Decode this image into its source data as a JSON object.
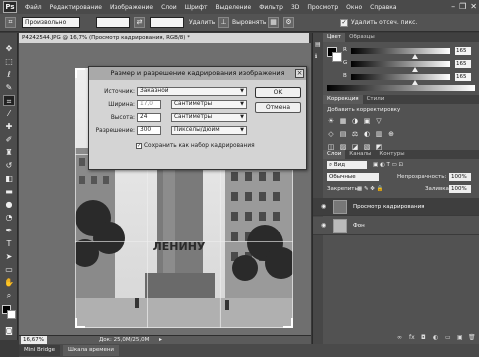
{
  "app": {
    "logo": "Ps"
  },
  "menubar": {
    "items": [
      "Файл",
      "Редактирование",
      "Изображение",
      "Слои",
      "Шрифт",
      "Выделение",
      "Фильтр",
      "3D",
      "Просмотр",
      "Окно",
      "Справка"
    ]
  },
  "optionsbar": {
    "ratio": "Произвольно",
    "clear_label": "Удалить",
    "straighten_label": "Выровнять",
    "delete_pixels_label": "Удалить отсеч. пикс."
  },
  "document": {
    "tab_title": "P4242544.JPG @ 16,7% (Просмотр кадрирования, RGB/8) *",
    "zoom": "16,67%",
    "doc_size": "Док: 25,0M/25,0M"
  },
  "dialog": {
    "title": "Размер и разрешение кадрирования изображения",
    "source_label": "Источник:",
    "source_value": "Заказной",
    "width_label": "Ширина:",
    "width_value": "17,0",
    "height_label": "Высота:",
    "height_value": "24",
    "resolution_label": "Разрешение:",
    "resolution_value": "300",
    "unit_cm": "Сантиметры",
    "unit_ppi": "Пикселы/дюйм",
    "save_preset_label": "Сохранить как набор кадрирования",
    "ok_label": "OK",
    "cancel_label": "Отмена"
  },
  "colorpanel": {
    "tabs": [
      "Цвет",
      "Образцы"
    ],
    "channels": [
      {
        "label": "R",
        "value": "165",
        "pos": 0.65
      },
      {
        "label": "G",
        "value": "165",
        "pos": 0.65
      },
      {
        "label": "B",
        "value": "165",
        "pos": 0.65
      }
    ]
  },
  "adjustments": {
    "tabs": [
      "Коррекция",
      "Стили"
    ],
    "subtitle": "Добавить корректировку",
    "icons": [
      "☀",
      "▦",
      "◑",
      "▣",
      "▽",
      "◇",
      "▤",
      "⚖",
      "◐",
      "▥",
      "⊕",
      "◫",
      "▨",
      "◪",
      "▧",
      "◩"
    ]
  },
  "layerspanel": {
    "tabs": [
      "Слои",
      "Каналы",
      "Контуры"
    ],
    "kind_label": "Вид",
    "blend_mode": "Обычные",
    "opacity_label": "Непрозрачность:",
    "opacity_value": "100%",
    "lock_label": "Закрепить:",
    "fill_label": "Заливка:",
    "fill_value": "100%",
    "layers": [
      {
        "name": "Просмотр кадрирования"
      },
      {
        "name": "Фон"
      }
    ],
    "bottom_icons": [
      "∞",
      "fx",
      "◘",
      "◐",
      "▭",
      "▣",
      "🗑"
    ]
  },
  "bottomtabs": [
    "Mini Bridge",
    "Шкала времени"
  ],
  "photo": {
    "sign_text": "ЛЕНИНУ"
  },
  "colors": {
    "accent": "#a9a9a9",
    "panel": "#525252",
    "canvas": "#6f6f6f"
  }
}
